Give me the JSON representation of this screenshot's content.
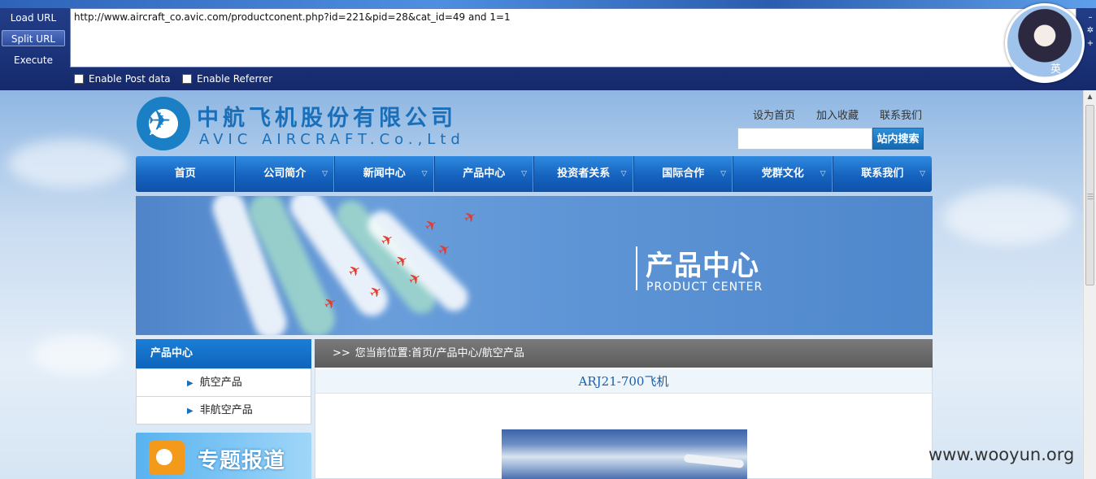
{
  "hackbar": {
    "buttons": {
      "load": "Load URL",
      "split": "Split URL",
      "execute": "Execute"
    },
    "url": "http://www.aircraft_co.avic.com/productconent.php?id=221&pid=28&cat_id=49 and 1=1",
    "checks": {
      "post": "Enable Post data",
      "referrer": "Enable Referrer"
    },
    "avatar_badge": "英"
  },
  "header": {
    "logo_cn": "中航飞机股份有限公司",
    "logo_en": "AVIC AIRCRAFT.Co.,Ltd",
    "logo_emblem_text": "AVIC",
    "links": [
      "设为首页",
      "加入收藏",
      "联系我们"
    ],
    "search_button": "站内搜索"
  },
  "nav": [
    "首页",
    "公司简介",
    "新闻中心",
    "产品中心",
    "投资者关系",
    "国际合作",
    "党群文化",
    "联系我们"
  ],
  "banner": {
    "title_cn": "产品中心",
    "title_en": "PRODUCT CENTER"
  },
  "sidebar": {
    "heading": "产品中心",
    "items": [
      "航空产品",
      "非航空产品"
    ],
    "topic_banner": "专题报道"
  },
  "content": {
    "breadcrumb_arrow": ">>",
    "breadcrumb": "您当前位置:首页/产品中心/航空产品",
    "product_title": "ARJ21-700飞机"
  },
  "watermark": "www.wooyun.org"
}
